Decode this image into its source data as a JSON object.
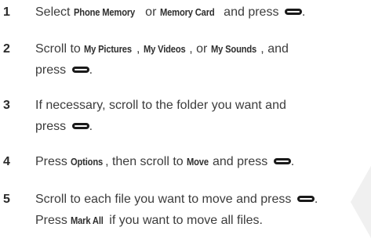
{
  "steps": [
    {
      "number": "1",
      "parts": [
        "Select ",
        "Phone Memory",
        " or ",
        "Memory Card",
        " and press",
        "."
      ]
    },
    {
      "number": "2",
      "line1": [
        "Scroll to ",
        "My Pictures",
        ", ",
        "My Videos",
        ", or ",
        "My Sounds",
        ", and"
      ],
      "line2": [
        "press",
        "."
      ]
    },
    {
      "number": "3",
      "line1": [
        "If necessary, scroll to the folder you want and"
      ],
      "line2": [
        "press",
        "."
      ]
    },
    {
      "number": "4",
      "parts": [
        "Press ",
        "Options",
        ", then scroll to ",
        "Move",
        " and press",
        "."
      ]
    },
    {
      "number": "5",
      "line1": [
        "Scroll to each file you want to move and press",
        "."
      ],
      "line2": [
        "Press ",
        "Mark All",
        " if you want to move all files."
      ]
    }
  ],
  "icons": {
    "select_key": "center-select-key-icon"
  }
}
